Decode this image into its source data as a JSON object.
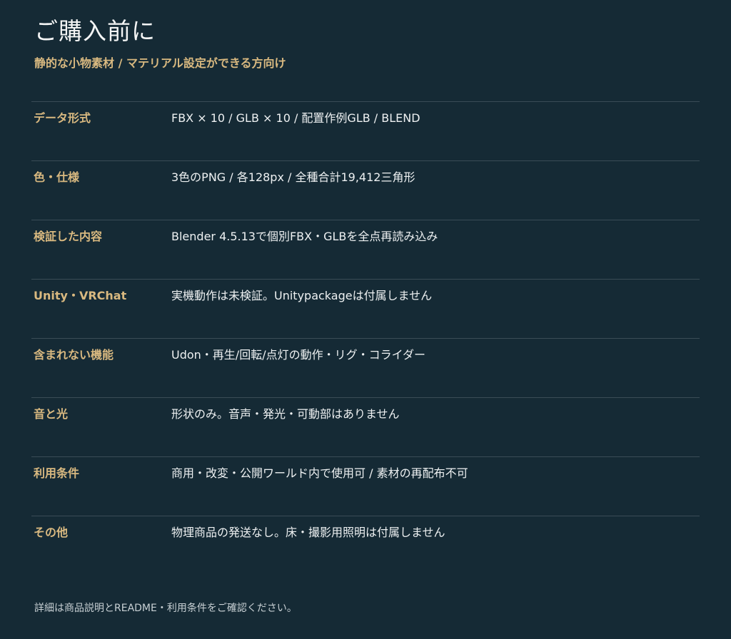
{
  "header": {
    "title": "ご購入前に",
    "subtitle": "静的な小物素材 / マテリアル設定ができる方向け"
  },
  "specs": [
    {
      "label": "データ形式",
      "value": "FBX × 10 / GLB × 10 / 配置作例GLB / BLEND"
    },
    {
      "label": "色・仕様",
      "value": "3色のPNG / 各128px / 全種合計19,412三角形"
    },
    {
      "label": "検証した内容",
      "value": "Blender 4.5.13で個別FBX・GLBを全点再読み込み"
    },
    {
      "label": "Unity・VRChat",
      "value": "実機動作は未検証。Unitypackageは付属しません"
    },
    {
      "label": "含まれない機能",
      "value": "Udon・再生/回転/点灯の動作・リグ・コライダー"
    },
    {
      "label": "音と光",
      "value": "形状のみ。音声・発光・可動部はありません"
    },
    {
      "label": "利用条件",
      "value": "商用・改変・公開ワールド内で使用可 / 素材の再配布不可"
    },
    {
      "label": "その他",
      "value": "物理商品の発送なし。床・撮影用照明は付属しません"
    }
  ],
  "footer": {
    "note": "詳細は商品説明とREADME・利用条件をご確認ください。"
  },
  "colors": {
    "background": "#152a35",
    "accent": "#d9b980",
    "text": "#eef1f2",
    "divider": "#3a4c56"
  }
}
